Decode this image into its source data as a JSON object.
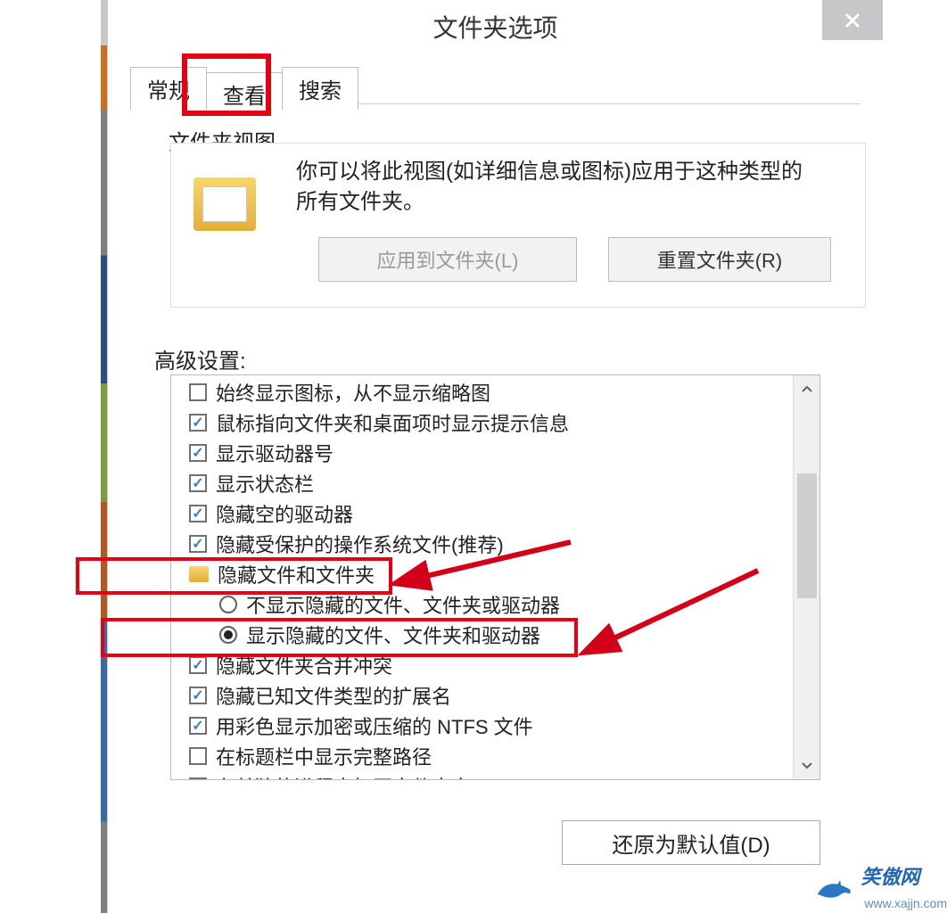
{
  "window": {
    "title": "文件夹选项"
  },
  "tabs": {
    "general": "常规",
    "view": "查看",
    "search": "搜索"
  },
  "folder_view": {
    "section_label": "文件夹视图",
    "description": "你可以将此视图(如详细信息或图标)应用于这种类型的所有文件夹。",
    "apply_button": "应用到文件夹(L)",
    "reset_button": "重置文件夹(R)"
  },
  "advanced": {
    "section_label": "高级设置:",
    "items": [
      {
        "type": "check",
        "checked": false,
        "text": "始终显示图标，从不显示缩略图"
      },
      {
        "type": "check",
        "checked": true,
        "text": "鼠标指向文件夹和桌面项时显示提示信息"
      },
      {
        "type": "check",
        "checked": true,
        "text": "显示驱动器号"
      },
      {
        "type": "check",
        "checked": true,
        "text": "显示状态栏"
      },
      {
        "type": "check",
        "checked": true,
        "text": "隐藏空的驱动器"
      },
      {
        "type": "check",
        "checked": true,
        "text": "隐藏受保护的操作系统文件(推荐)"
      },
      {
        "type": "group",
        "text": "隐藏文件和文件夹"
      },
      {
        "type": "radio",
        "checked": false,
        "text": "不显示隐藏的文件、文件夹或驱动器"
      },
      {
        "type": "radio",
        "checked": true,
        "text": "显示隐藏的文件、文件夹和驱动器"
      },
      {
        "type": "check",
        "checked": true,
        "text": "隐藏文件夹合并冲突"
      },
      {
        "type": "check",
        "checked": true,
        "text": "隐藏已知文件类型的扩展名"
      },
      {
        "type": "check",
        "checked": true,
        "text": "用彩色显示加密或压缩的 NTFS 文件"
      },
      {
        "type": "check",
        "checked": false,
        "text": "在标题栏中显示完整路径"
      },
      {
        "type": "check",
        "checked": false,
        "text": "在单独的进程中打开文件夹窗口"
      }
    ]
  },
  "restore_button": "还原为默认值(D)",
  "watermark": {
    "name": "笑傲网",
    "url": "www.xajjn.com"
  }
}
